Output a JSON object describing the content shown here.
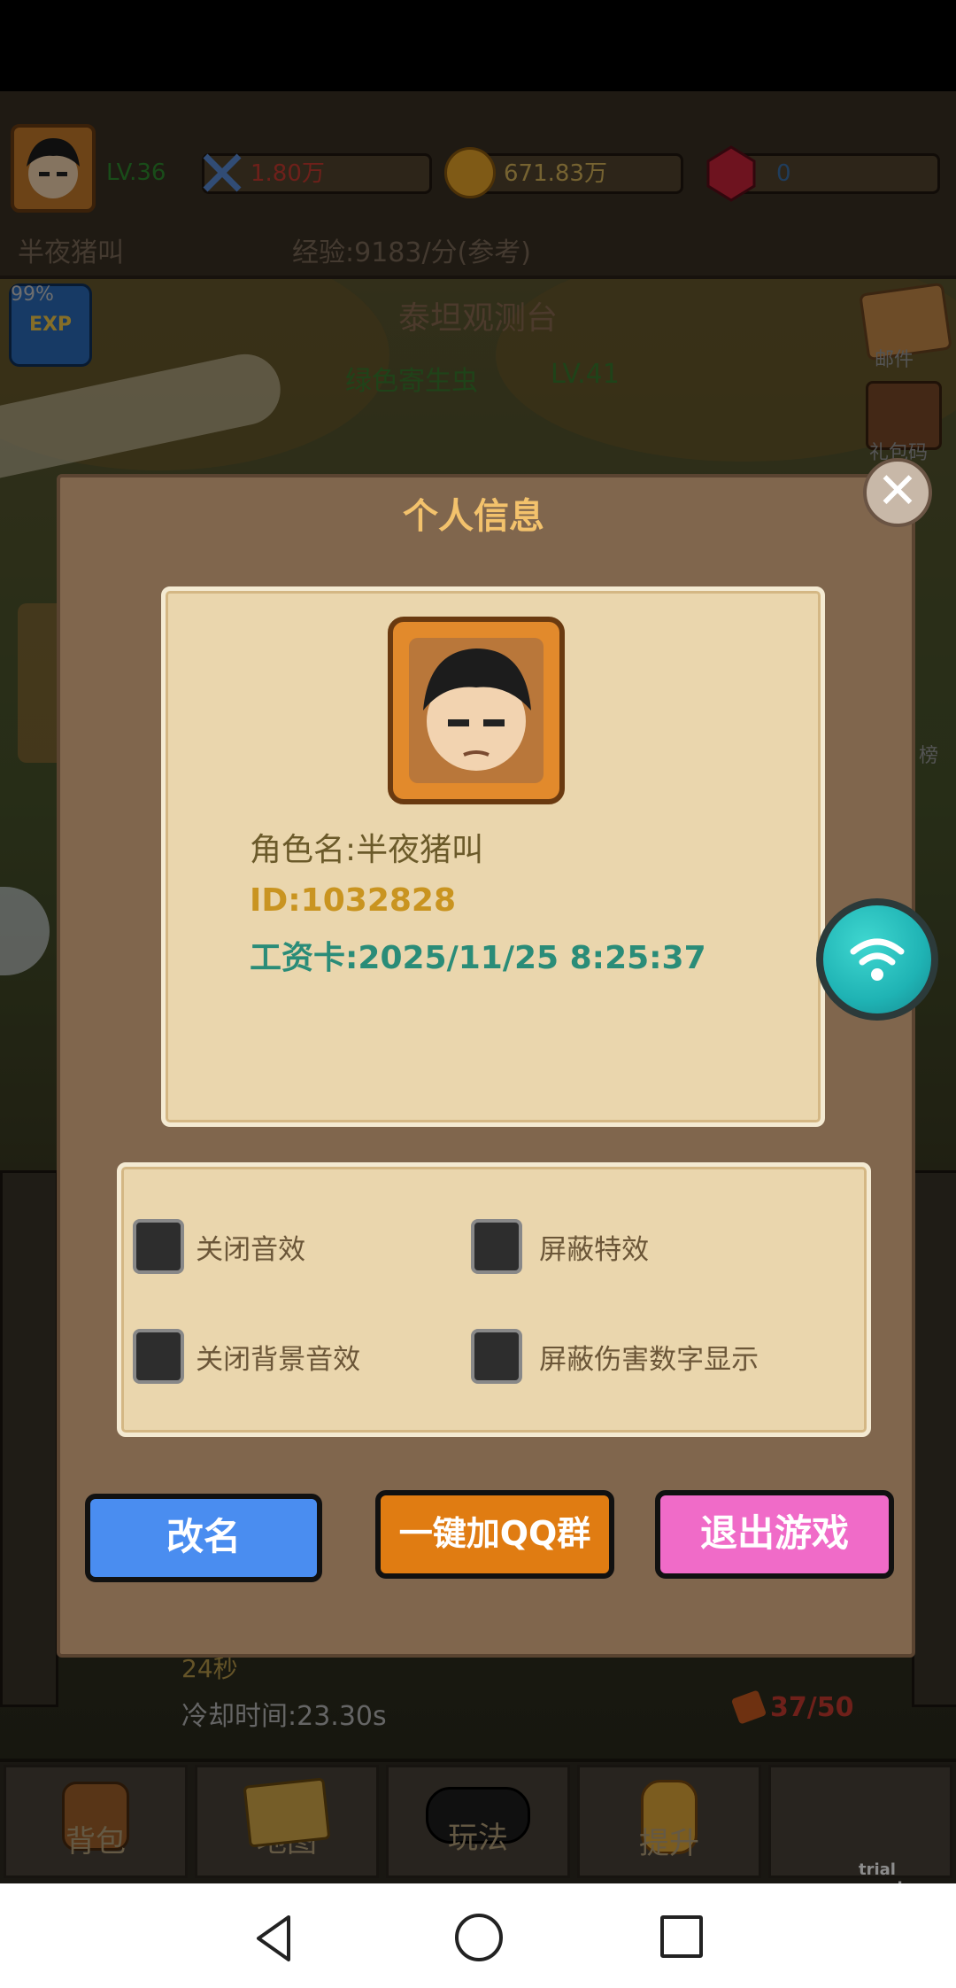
{
  "header": {
    "level": "LV.36",
    "power": "1.80万",
    "gold": "671.83万",
    "gems": "0",
    "player_name": "半夜猪叫",
    "exp_rate": "经验:9183/分(参考)"
  },
  "scene": {
    "exp_percent": "99%",
    "exp_badge": "EXP",
    "location": "泰坦观测台",
    "enemy_name": "绿色寄生虫",
    "enemy_level": "LV.41",
    "mail_label": "邮件",
    "gift_label": "礼包码",
    "partial_label": "榜",
    "timer_short": "24秒",
    "cooldown": "冷却时间:23.30s",
    "stamina": "37/50"
  },
  "dialog": {
    "title": "个人信息",
    "role_name": "角色名:半夜猪叫",
    "id": "ID:1032828",
    "salary_card": "工资卡:2025/11/25 8:25:37",
    "options": [
      {
        "label": "关闭音效",
        "checked": false
      },
      {
        "label": "屏蔽特效",
        "checked": false
      },
      {
        "label": "关闭背景音效",
        "checked": false
      },
      {
        "label": "屏蔽伤害数字显示",
        "checked": false
      }
    ],
    "rename_button": "改名",
    "qq_button": "一键加QQ群",
    "exit_button": "退出游戏"
  },
  "nav": {
    "bag": "背包",
    "map": "地图",
    "gameplay": "玩法",
    "upgrade": "提升"
  },
  "watermark": "trial version",
  "colors": {
    "rename": "#4a8df0",
    "qq": "#e07c12",
    "exit": "#f06bc8",
    "title": "#f3c26c",
    "id": "#c99420",
    "salary": "#2a8c78",
    "wifi": "#1fb3b4"
  }
}
